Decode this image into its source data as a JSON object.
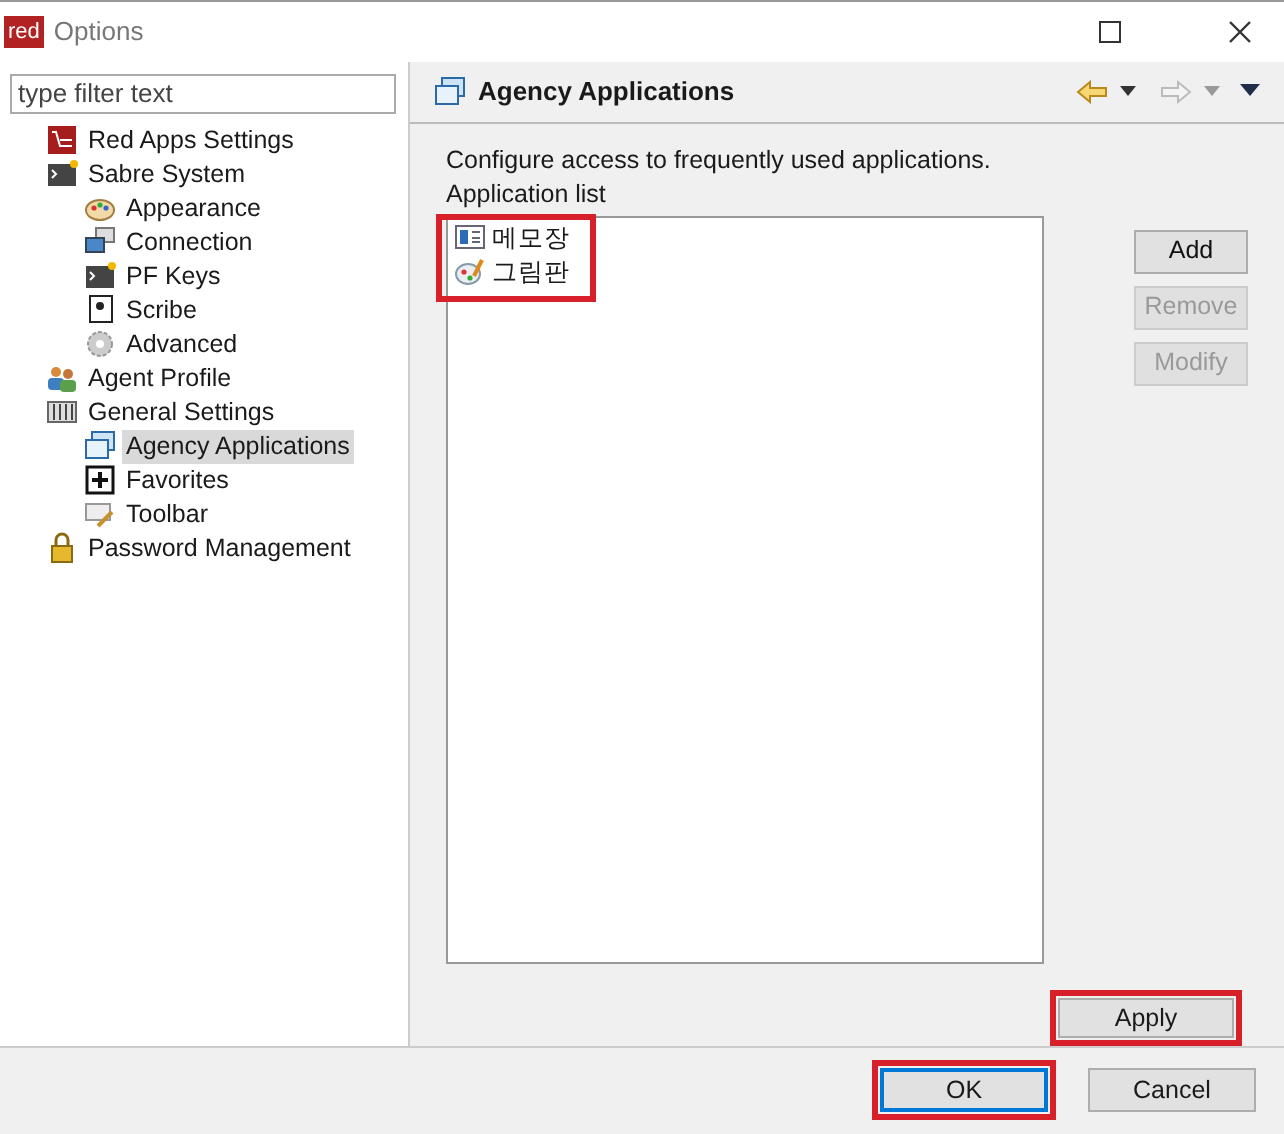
{
  "window": {
    "title": "Options",
    "logo": "red"
  },
  "filter": {
    "placeholder": "type filter text"
  },
  "tree": [
    {
      "label": "Red Apps Settings",
      "selected": false
    },
    {
      "label": "Sabre System",
      "selected": false,
      "children": [
        {
          "label": "Appearance",
          "selected": false
        },
        {
          "label": "Connection",
          "selected": false
        },
        {
          "label": "PF Keys",
          "selected": false
        },
        {
          "label": "Scribe",
          "selected": false
        },
        {
          "label": "Advanced",
          "selected": false
        }
      ]
    },
    {
      "label": "Agent Profile",
      "selected": false
    },
    {
      "label": "General Settings",
      "selected": false,
      "children": [
        {
          "label": "Agency Applications",
          "selected": true
        },
        {
          "label": "Favorites",
          "selected": false
        },
        {
          "label": "Toolbar",
          "selected": false
        }
      ]
    },
    {
      "label": "Password Management",
      "selected": false
    }
  ],
  "page": {
    "title": "Agency Applications",
    "description": "Configure access to frequently used applications.",
    "list_label": "Application list",
    "applications": [
      {
        "label": "메모장",
        "selected": false
      },
      {
        "label": "그림판",
        "selected": false
      }
    ],
    "applications_highlighted": true,
    "side_buttons": [
      {
        "label": "Add",
        "disabled": false
      },
      {
        "label": "Remove",
        "disabled": true
      },
      {
        "label": "Modify",
        "disabled": true
      }
    ],
    "apply": {
      "label": "Apply",
      "highlighted": true
    }
  },
  "buttons": [
    {
      "label": "OK",
      "default": true,
      "highlighted": true
    },
    {
      "label": "Cancel",
      "default": false,
      "highlighted": false
    }
  ]
}
